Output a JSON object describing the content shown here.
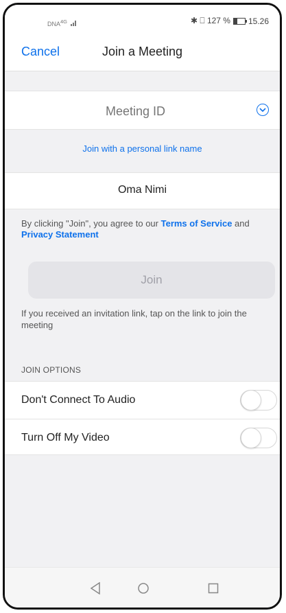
{
  "statusbar": {
    "carrier": "DNA",
    "network": "4G",
    "status_right": "✱ ⎕ 127 %",
    "time": "15.26"
  },
  "nav": {
    "cancel_label": "Cancel",
    "title": "Join a Meeting"
  },
  "meeting_id": {
    "placeholder": "Meeting ID"
  },
  "personal_link_label": "Join with a personal link name",
  "name_field": {
    "value": "Oma Nimi"
  },
  "terms": {
    "prefix": "By clicking \"Join\", you agree to our ",
    "tos_label": "Terms of Service",
    "and": " and ",
    "privacy_label": "Privacy Statement"
  },
  "join_button_label": "Join",
  "invite_note": "If you received an invitation link, tap on the link to join the meeting",
  "join_options": {
    "header": "JOIN OPTIONS",
    "items": [
      {
        "label": "Don't Connect To Audio",
        "enabled": false
      },
      {
        "label": "Turn Off My Video",
        "enabled": false
      }
    ]
  },
  "colors": {
    "accent": "#0e71eb",
    "background": "#f1f1f3"
  }
}
